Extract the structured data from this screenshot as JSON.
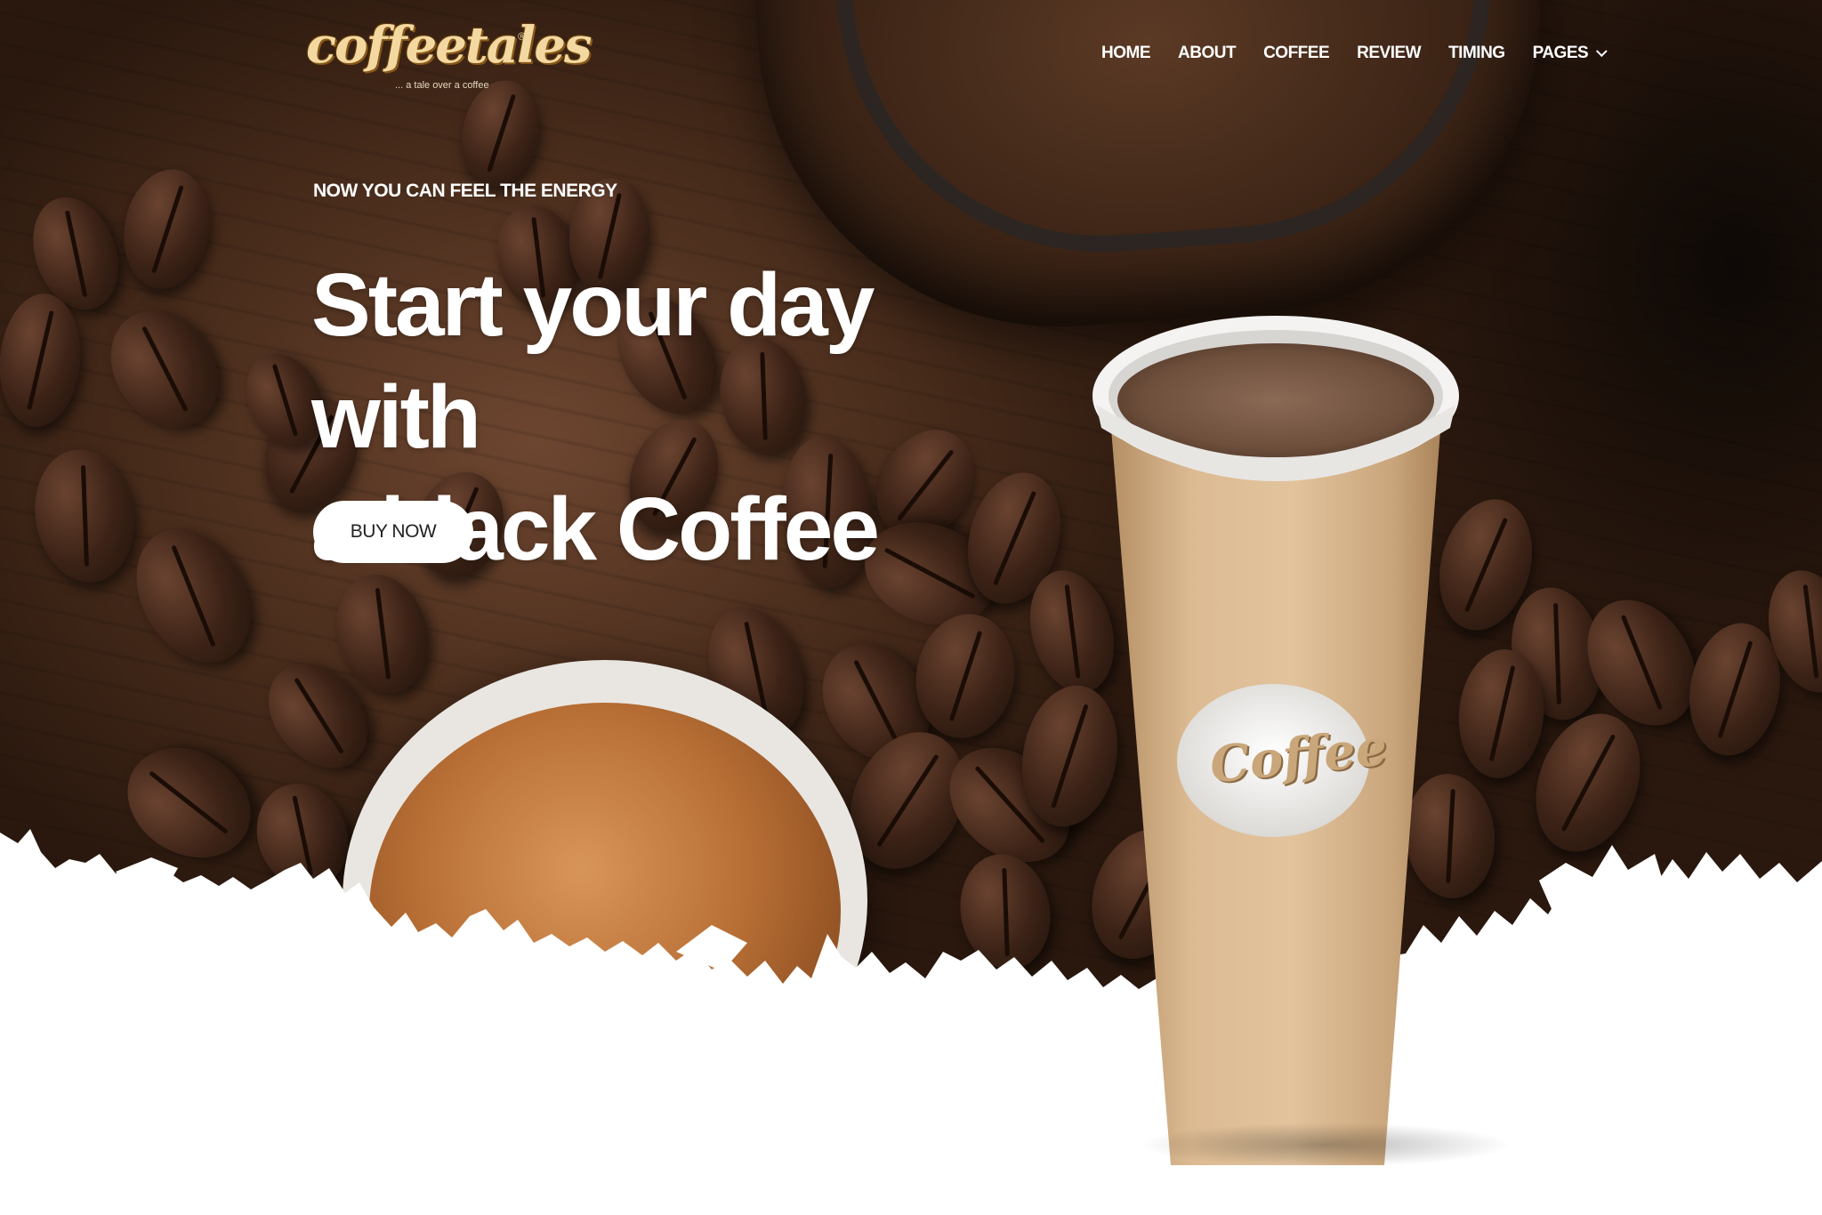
{
  "brand": {
    "logo_text": "coffeetales",
    "registered_mark": "®",
    "tagline": "... a tale over a coffee"
  },
  "nav": {
    "items": [
      {
        "label": "HOME"
      },
      {
        "label": "ABOUT"
      },
      {
        "label": "COFFEE"
      },
      {
        "label": "REVIEW"
      },
      {
        "label": "TIMING"
      },
      {
        "label": "PAGES",
        "icon": "chevron-down-icon"
      }
    ]
  },
  "hero": {
    "eyebrow": "NOW YOU CAN FEEL THE ENERGY",
    "headline_line1": "Start your day with",
    "headline_line2": "a black Coffee",
    "cta_label": "BUY NOW",
    "cup_label": "Coffee"
  },
  "colors": {
    "background_wood": "#4a2d1c",
    "paper_white": "#ffffff",
    "cup_tan": "#d8b48b",
    "logo_gold": "#f3d9a1"
  }
}
